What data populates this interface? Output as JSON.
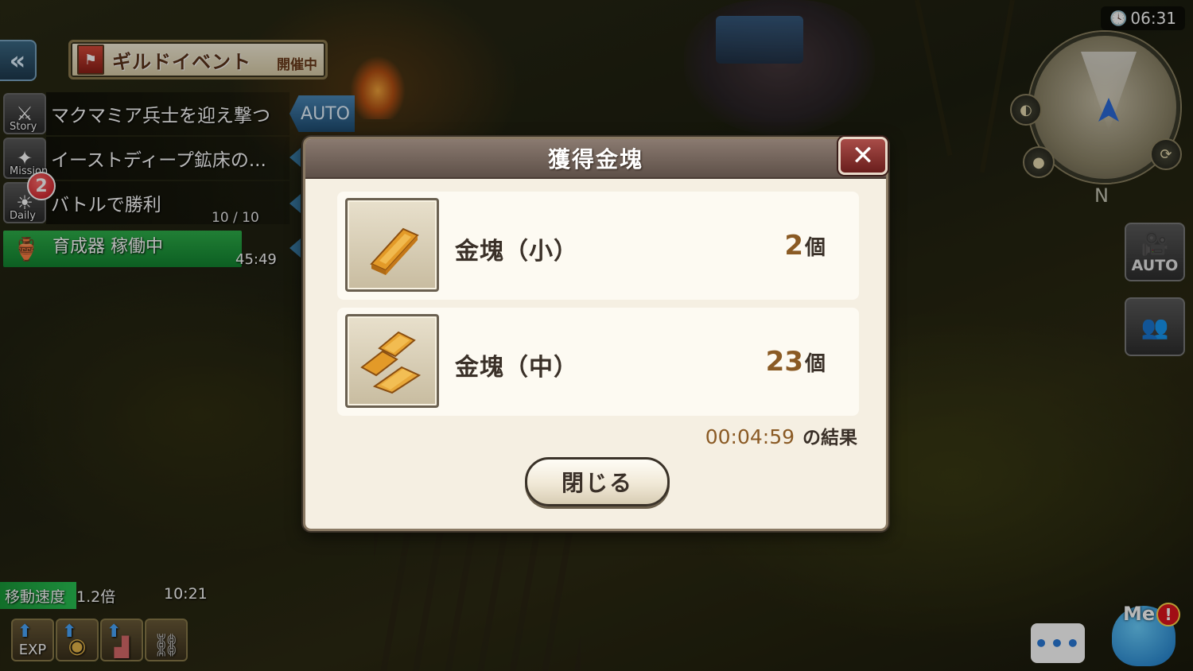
{
  "hud": {
    "back_icon": "«",
    "guild_event": {
      "title": "ギルドイベント",
      "status": "開催中"
    },
    "quests": [
      {
        "tag": "Story",
        "text": "マクマミア兵士を迎え撃つ"
      },
      {
        "tag": "Mission",
        "text": "イーストディープ鉱床の..."
      },
      {
        "tag": "Daily",
        "text": "バトルで勝利",
        "progress": "10 / 10",
        "badge": "2"
      }
    ],
    "auto_label": "AUTO",
    "incubator": {
      "label": "育成器 稼働中",
      "time": "45:49"
    },
    "speed": {
      "label": "移動速度",
      "value": "1.2倍",
      "time": "10:21"
    },
    "boosts": [
      {
        "label": "EXP",
        "icon": "exp-boost-icon"
      },
      {
        "label": "",
        "icon": "gold-boost-icon"
      },
      {
        "label": "",
        "icon": "drop-boost-icon"
      },
      {
        "label": "",
        "icon": "cage-icon"
      }
    ],
    "clock": "06:31",
    "compass": "N",
    "auto_camera_label": "AUTO",
    "chat_label": "•••",
    "me_label": "Me",
    "me_alert": "!"
  },
  "dialog": {
    "title": "獲得金塊",
    "close_icon": "✕",
    "items": [
      {
        "name": "金塊（小）",
        "count": "2",
        "unit": "個",
        "icon": "gold-bar-small-icon"
      },
      {
        "name": "金塊（中）",
        "count": "23",
        "unit": "個",
        "icon": "gold-bar-medium-icon"
      }
    ],
    "elapsed": "00:04:59",
    "elapsed_suffix": "の結果",
    "close_button": "閉じる"
  },
  "colors": {
    "accent_gold": "#8a5a24",
    "header_bg": "#6e5f57",
    "incubator_green": "#1e9a3c",
    "auto_blue": "#2f6a96"
  }
}
